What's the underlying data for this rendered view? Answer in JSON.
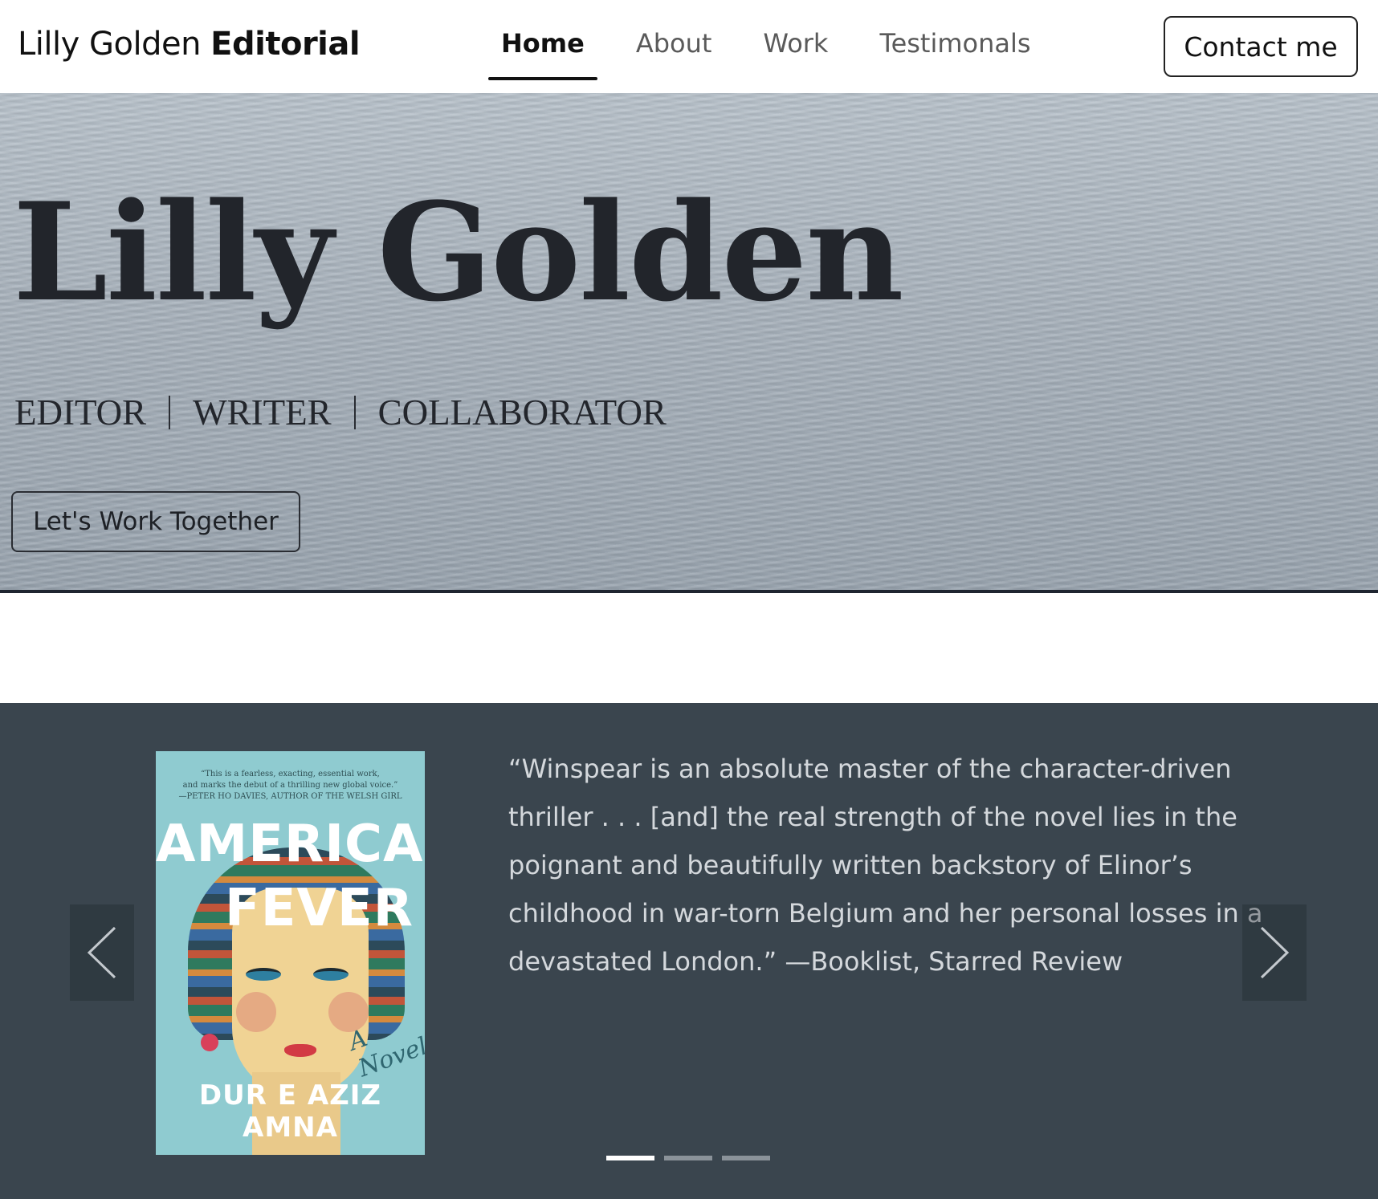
{
  "header": {
    "brand_light": "Lilly Golden",
    "brand_bold": "Editorial",
    "nav": [
      {
        "label": "Home",
        "active": true
      },
      {
        "label": "About",
        "active": false
      },
      {
        "label": "Work",
        "active": false
      },
      {
        "label": "Testimonals",
        "active": false
      }
    ],
    "contact_label": "Contact me"
  },
  "hero": {
    "title": "Lilly Golden",
    "roles": [
      "EDITOR",
      "WRITER",
      "COLLABORATOR"
    ],
    "cta_label": "Let's Work Together"
  },
  "testimonials": {
    "book": {
      "blurb_line1": "“This is a fearless, exacting, essential work,",
      "blurb_line2": "and marks the debut of a thrilling new global voice.”",
      "blurb_line3": "—PETER HO DAVIES, AUTHOR OF THE WELSH GIRL",
      "title_line1": "AMERICAN",
      "title_line2": "FEVER",
      "subtitle": "A Novel",
      "author": "DUR E AZIZ AMNA"
    },
    "quote": "“Winspear is an absolute master of the character-driven thriller . . . [and] the real strength of the novel lies in the poignant and beautifully written backstory of Elinor’s childhood in war-torn Belgium and her personal losses in a devastated London.” —Booklist, Starred Review",
    "slides_total": 3,
    "active_slide": 1
  },
  "colors": {
    "carousel_bg": "#3a454e",
    "quote_text": "#d4d8dc",
    "hero_water": "#a8b2bc"
  },
  "icons": {
    "prev": "chevron-left-icon",
    "next": "chevron-right-icon"
  }
}
